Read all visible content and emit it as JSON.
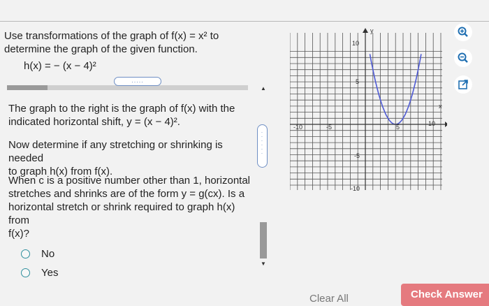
{
  "question": {
    "line1": "Use transformations of the graph of f(x) = x² to",
    "line2": "determine the graph of the given function.",
    "function": "h(x) = − (x − 4)²"
  },
  "expand_pill": ".....",
  "body": {
    "para1_line1": "The graph to the right is the graph of f(x) with the",
    "para1_line2": "indicated horizontal shift, y = (x − 4)².",
    "para2_line1": "Now determine if any stretching or shrinking is needed",
    "para2_line2": "to graph h(x) from f(x).",
    "para3_line1": "When c is a positive number other than 1, horizontal",
    "para3_line2": "stretches and shrinks are of the form y = g(cx). Is a",
    "para3_line3": "horizontal stretch or shrink required to graph h(x) from",
    "para3_line4": "f(x)?"
  },
  "options": [
    "No",
    "Yes"
  ],
  "graph": {
    "x_label": "x",
    "y_label": "y",
    "x_ticks": [
      "-10",
      "-5",
      "5",
      "10"
    ],
    "y_ticks": [
      "10",
      "5",
      "-5",
      "-10"
    ],
    "curve": "y = (x − 4)²",
    "curve_color": "#4f5bd5"
  },
  "tools": [
    "zoom-in-icon",
    "zoom-out-icon",
    "popout-icon"
  ],
  "footer": {
    "clear": "Clear All",
    "check": "Check Answer"
  }
}
